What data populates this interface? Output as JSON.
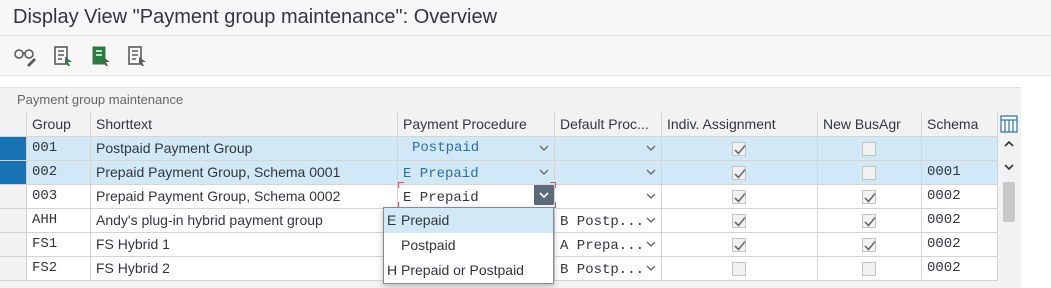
{
  "window": {
    "title": "Display View \"Payment group maintenance\": Overview"
  },
  "toolbar": {
    "buttons": [
      {
        "icon": "glasses-pencil-icon"
      },
      {
        "icon": "table-export-icon"
      },
      {
        "icon": "table-select-icon"
      },
      {
        "icon": "document-select-icon"
      }
    ]
  },
  "panel": {
    "title": "Payment group maintenance"
  },
  "table": {
    "headers": [
      "Group",
      "Shorttext",
      "Payment Procedure",
      "Default Proc...",
      "Indiv. Assignment",
      "New BusAgr",
      "Schema"
    ],
    "rows": [
      {
        "group": "001",
        "shorttext": "Postpaid Payment Group",
        "payment_procedure": "Postpaid",
        "default_proc": "",
        "indiv_assignment": true,
        "new_busagr": false,
        "schema": "",
        "selected": true
      },
      {
        "group": "002",
        "shorttext": "Prepaid Payment Group, Schema 0001",
        "payment_procedure": "E Prepaid",
        "default_proc": "",
        "indiv_assignment": true,
        "new_busagr": false,
        "schema": "0001",
        "selected": true
      },
      {
        "group": "003",
        "shorttext": "Prepaid Payment Group, Schema 0002",
        "payment_procedure": "E Prepaid",
        "default_proc": "",
        "indiv_assignment": true,
        "new_busagr": true,
        "schema": "0002",
        "selected": false
      },
      {
        "group": "AHH",
        "shorttext": "Andy's plug-in hybrid payment group",
        "payment_procedure": "",
        "default_proc": "B Postp...",
        "indiv_assignment": true,
        "new_busagr": true,
        "schema": "0002",
        "selected": false
      },
      {
        "group": "FS1",
        "shorttext": "FS Hybrid 1",
        "payment_procedure": "",
        "default_proc": "A Prepa...",
        "indiv_assignment": true,
        "new_busagr": true,
        "schema": "0002",
        "selected": false
      },
      {
        "group": "FS2",
        "shorttext": "FS Hybrid 2",
        "payment_procedure": "",
        "default_proc": "B Postp...",
        "indiv_assignment": false,
        "new_busagr": false,
        "schema": "0002",
        "selected": false
      }
    ]
  },
  "dropdown": {
    "options": [
      {
        "key": "E",
        "label": "Prepaid",
        "highlighted": true
      },
      {
        "key": "",
        "label": "Postpaid",
        "highlighted": false
      },
      {
        "key": "H",
        "label": "Prepaid or Postpaid",
        "highlighted": false
      }
    ]
  },
  "colors": {
    "selection_blue": "#1873b4",
    "row_selected": "#d1e8f7",
    "value_blue": "#2a6fa8",
    "focus_red": "#e0506e"
  }
}
